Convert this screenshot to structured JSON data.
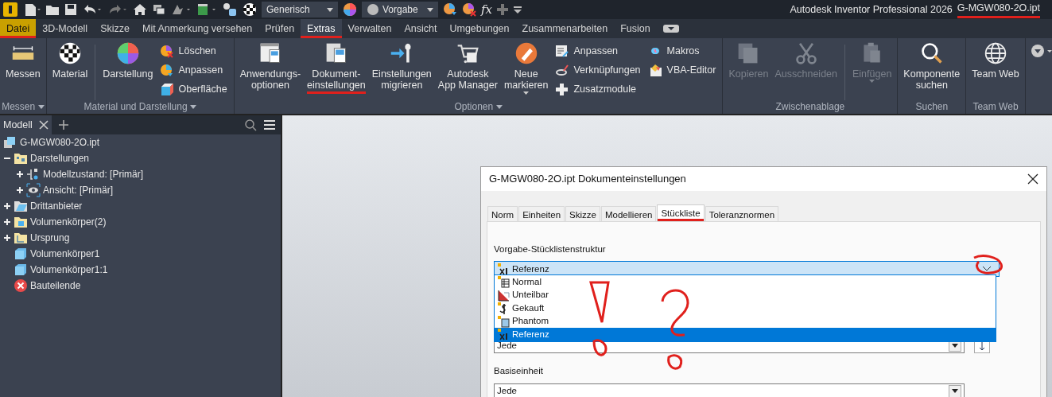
{
  "quick_access": {
    "style_dropdown": "Generisch",
    "appearance_dropdown": "Vorgabe",
    "formula_button": "fx"
  },
  "title": {
    "app": "Autodesk Inventor Professional 2026",
    "file": "G-MGW080-2O.ipt",
    "file_underlined": true
  },
  "ribbon_tabs": [
    {
      "kind": "app-menu",
      "label": "Datei",
      "selected": false,
      "underlined": true
    },
    {
      "kind": "tab",
      "label": "3D-Modell",
      "selected": false,
      "underlined": false
    },
    {
      "kind": "tab",
      "label": "Skizze",
      "selected": false,
      "underlined": false
    },
    {
      "kind": "tab",
      "label": "Mit Anmerkung versehen",
      "selected": false,
      "underlined": false
    },
    {
      "kind": "tab",
      "label": "Prüfen",
      "selected": false,
      "underlined": false
    },
    {
      "kind": "tab",
      "label": "Extras",
      "selected": true,
      "underlined": true
    },
    {
      "kind": "tab",
      "label": "Verwalten",
      "selected": false,
      "underlined": false
    },
    {
      "kind": "tab",
      "label": "Ansicht",
      "selected": false,
      "underlined": false
    },
    {
      "kind": "tab",
      "label": "Umgebungen",
      "selected": false,
      "underlined": false
    },
    {
      "kind": "tab",
      "label": "Zusammenarbeiten",
      "selected": false,
      "underlined": false
    },
    {
      "kind": "tab",
      "label": "Fusion",
      "selected": false,
      "underlined": false
    }
  ],
  "ribbon_panels": [
    {
      "label": "Messen",
      "dropdown": true,
      "tools": [
        {
          "kind": "large",
          "label": "Messen",
          "disabled": false,
          "caret": false,
          "underlined": false
        }
      ]
    },
    {
      "label": "Material und Darstellung",
      "dropdown": true,
      "tools": [
        {
          "kind": "large",
          "label": "Material",
          "disabled": false,
          "caret": false,
          "underlined": false
        },
        {
          "kind": "separator"
        },
        {
          "kind": "large",
          "label": "Darstellung",
          "disabled": false,
          "caret": false,
          "underlined": false
        },
        {
          "kind": "stack",
          "items": [
            {
              "label": "Löschen"
            },
            {
              "label": "Anpassen"
            },
            {
              "label": "Oberfläche"
            }
          ]
        }
      ]
    },
    {
      "label": "Optionen",
      "dropdown": true,
      "tools": [
        {
          "kind": "large",
          "label": "Anwendungs-\noptionen",
          "disabled": false,
          "caret": false,
          "underlined": false
        },
        {
          "kind": "large",
          "label": "Dokument-\neinstellungen",
          "disabled": false,
          "caret": false,
          "underlined": true
        },
        {
          "kind": "large",
          "label": "Einstellungen\nmigrieren",
          "disabled": false,
          "caret": false,
          "underlined": false
        },
        {
          "kind": "large",
          "label": "Autodesk\nApp Manager",
          "disabled": false,
          "caret": false,
          "underlined": false
        },
        {
          "kind": "large",
          "label": "Neue\nmarkieren",
          "disabled": false,
          "caret": true,
          "underlined": false
        },
        {
          "kind": "stack",
          "items": [
            {
              "label": "Anpassen"
            },
            {
              "label": "Verknüpfungen"
            },
            {
              "label": "Zusatzmodule"
            }
          ]
        },
        {
          "kind": "stack",
          "items": [
            {
              "label": "Makros"
            },
            {
              "label": "VBA-Editor"
            }
          ]
        }
      ]
    },
    {
      "label": "Zwischenablage",
      "dropdown": false,
      "tools": [
        {
          "kind": "large",
          "label": "Kopieren",
          "disabled": true,
          "caret": false,
          "underlined": false
        },
        {
          "kind": "large",
          "label": "Ausschneiden",
          "disabled": true,
          "caret": false,
          "underlined": false
        },
        {
          "kind": "separator"
        },
        {
          "kind": "large",
          "label": "Einfügen",
          "disabled": true,
          "caret": true,
          "underlined": false
        }
      ]
    },
    {
      "label": "Suchen",
      "dropdown": false,
      "tools": [
        {
          "kind": "large",
          "label": "Komponente\nsuchen",
          "disabled": false,
          "caret": false,
          "underlined": false
        }
      ]
    },
    {
      "label": "Team Web",
      "dropdown": false,
      "tools": [
        {
          "kind": "large",
          "label": "Team Web",
          "disabled": false,
          "caret": false,
          "underlined": false
        }
      ]
    }
  ],
  "browser": {
    "tab": "Modell",
    "tree": [
      {
        "label": "G-MGW080-2O.ipt",
        "children": [
          {
            "label": "Darstellungen",
            "expanded": true,
            "children": [
              {
                "label": "Modellzustand: [Primär]",
                "expanded": false
              },
              {
                "label": "Ansicht: [Primär]",
                "expanded": false
              }
            ]
          },
          {
            "label": "Drittanbieter",
            "expanded": false
          },
          {
            "label": "Volumenkörper(2)",
            "expanded": false
          },
          {
            "label": "Ursprung",
            "expanded": false
          },
          {
            "label": "Volumenkörper1"
          },
          {
            "label": "Volumenkörper1:1"
          },
          {
            "label": "Bauteilende"
          }
        ]
      }
    ]
  },
  "dialog": {
    "title": "G-MGW080-2O.ipt Dokumenteinstellungen",
    "tabs": [
      {
        "label": "Norm",
        "selected": false,
        "underlined": false
      },
      {
        "label": "Einheiten",
        "selected": false,
        "underlined": false
      },
      {
        "label": "Skizze",
        "selected": false,
        "underlined": false
      },
      {
        "label": "Modellieren",
        "selected": false,
        "underlined": false
      },
      {
        "label": "Stückliste",
        "selected": true,
        "underlined": true
      },
      {
        "label": "Toleranznormen",
        "selected": false,
        "underlined": false
      }
    ],
    "structure_label": "Vorgabe-Stücklistenstruktur",
    "structure_combo": {
      "value": "Referenz",
      "circled": true,
      "options": [
        {
          "label": "Normal",
          "selected": false
        },
        {
          "label": "Unteilbar",
          "selected": false
        },
        {
          "label": "Gekauft",
          "selected": false
        },
        {
          "label": "Phantom",
          "selected": false
        },
        {
          "label": "Referenz",
          "selected": true
        }
      ]
    },
    "hidden_combo": {
      "value": "Jede"
    },
    "base_unit_label": "Basiseinheit",
    "base_unit_combo": {
      "value": "Jede"
    },
    "scribbles": [
      {
        "kind": "exclamation"
      },
      {
        "kind": "question"
      }
    ]
  }
}
